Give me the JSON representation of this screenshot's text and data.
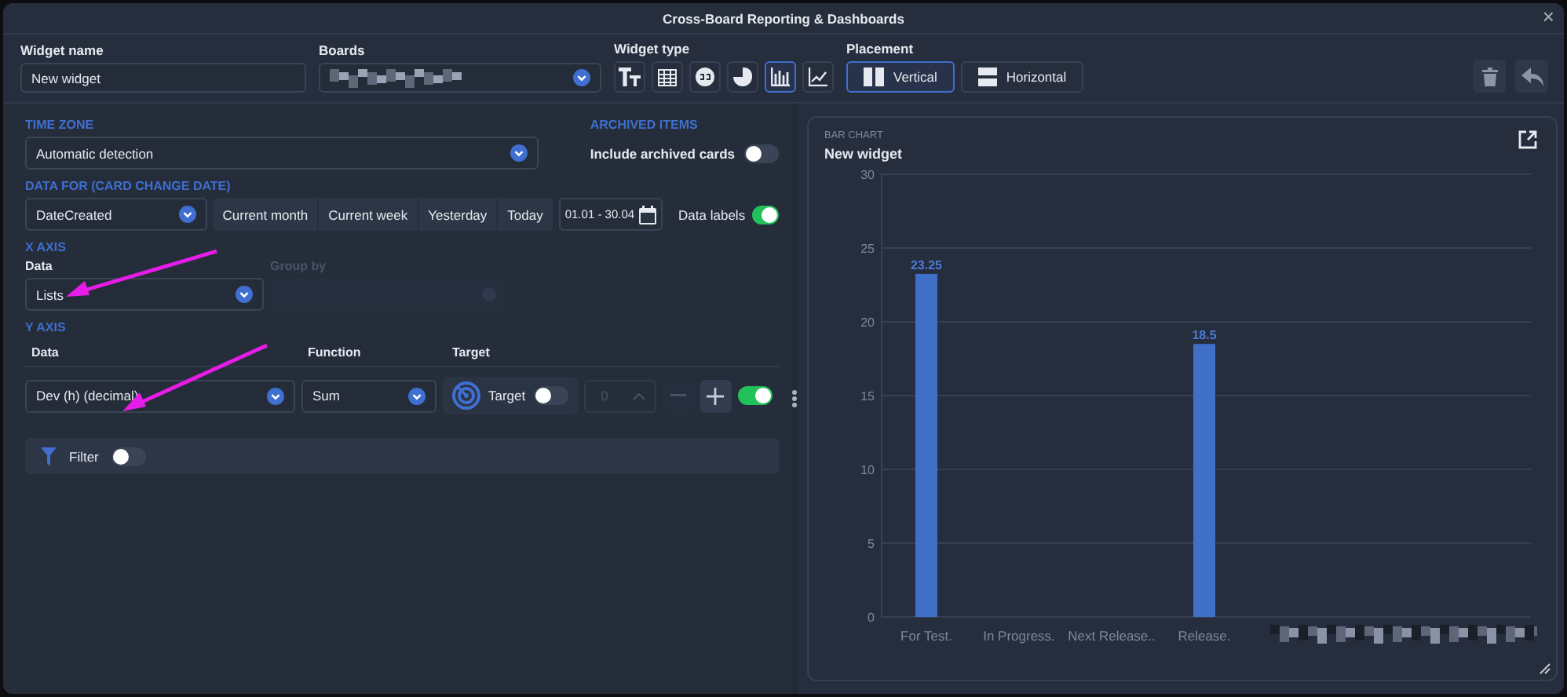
{
  "window": {
    "title": "Cross-Board Reporting & Dashboards",
    "close": "×"
  },
  "top": {
    "widget_name": {
      "label": "Widget name",
      "value": "New widget"
    },
    "boards": {
      "label": "Boards"
    },
    "widget_type": {
      "label": "Widget type",
      "types": [
        {
          "kind": "text",
          "selected": false
        },
        {
          "kind": "table",
          "selected": false
        },
        {
          "kind": "number",
          "selected": false
        },
        {
          "kind": "pie",
          "selected": false
        },
        {
          "kind": "bar",
          "selected": true
        },
        {
          "kind": "line",
          "selected": false
        }
      ]
    },
    "placement": {
      "label": "Placement",
      "options": [
        {
          "kind": "vertical",
          "label": "Vertical",
          "selected": true
        },
        {
          "kind": "horizontal",
          "label": "Horizontal",
          "selected": false
        }
      ]
    }
  },
  "time_zone": {
    "heading": "TIME ZONE",
    "value": "Automatic detection"
  },
  "archived": {
    "heading": "ARCHIVED ITEMS",
    "label": "Include archived cards",
    "on": false
  },
  "data_for": {
    "heading": "DATA FOR (CARD CHANGE DATE)",
    "value": "DateCreated",
    "periods": [
      "Current month",
      "Current week",
      "Yesterday",
      "Today"
    ],
    "range": "01.01 - 30.04",
    "data_labels": {
      "label": "Data labels",
      "on": true
    }
  },
  "x_axis": {
    "heading": "X AXIS",
    "data_label": "Data",
    "data_value": "Lists",
    "group_by_label": "Group by"
  },
  "y_axis": {
    "heading": "Y AXIS",
    "columns": [
      "Data",
      "Function",
      "Target"
    ],
    "data_value": "Dev (h) (decimal)",
    "function_value": "Sum",
    "target_label": "Target",
    "target_on": false,
    "target_value": "0",
    "enabled": true
  },
  "filter": {
    "label": "Filter",
    "on": false
  },
  "chart": {
    "kind_label": "BAR CHART",
    "title": "New widget",
    "chart_data": {
      "type": "bar",
      "categories": [
        "For Test.",
        "In Progress.",
        "Next Release..",
        "Release."
      ],
      "values": [
        23.25,
        null,
        null,
        18.5
      ],
      "ylim": [
        0,
        30
      ],
      "yticks": [
        0,
        5,
        10,
        15,
        20,
        25,
        30
      ],
      "grid": true,
      "data_labels": true
    }
  }
}
